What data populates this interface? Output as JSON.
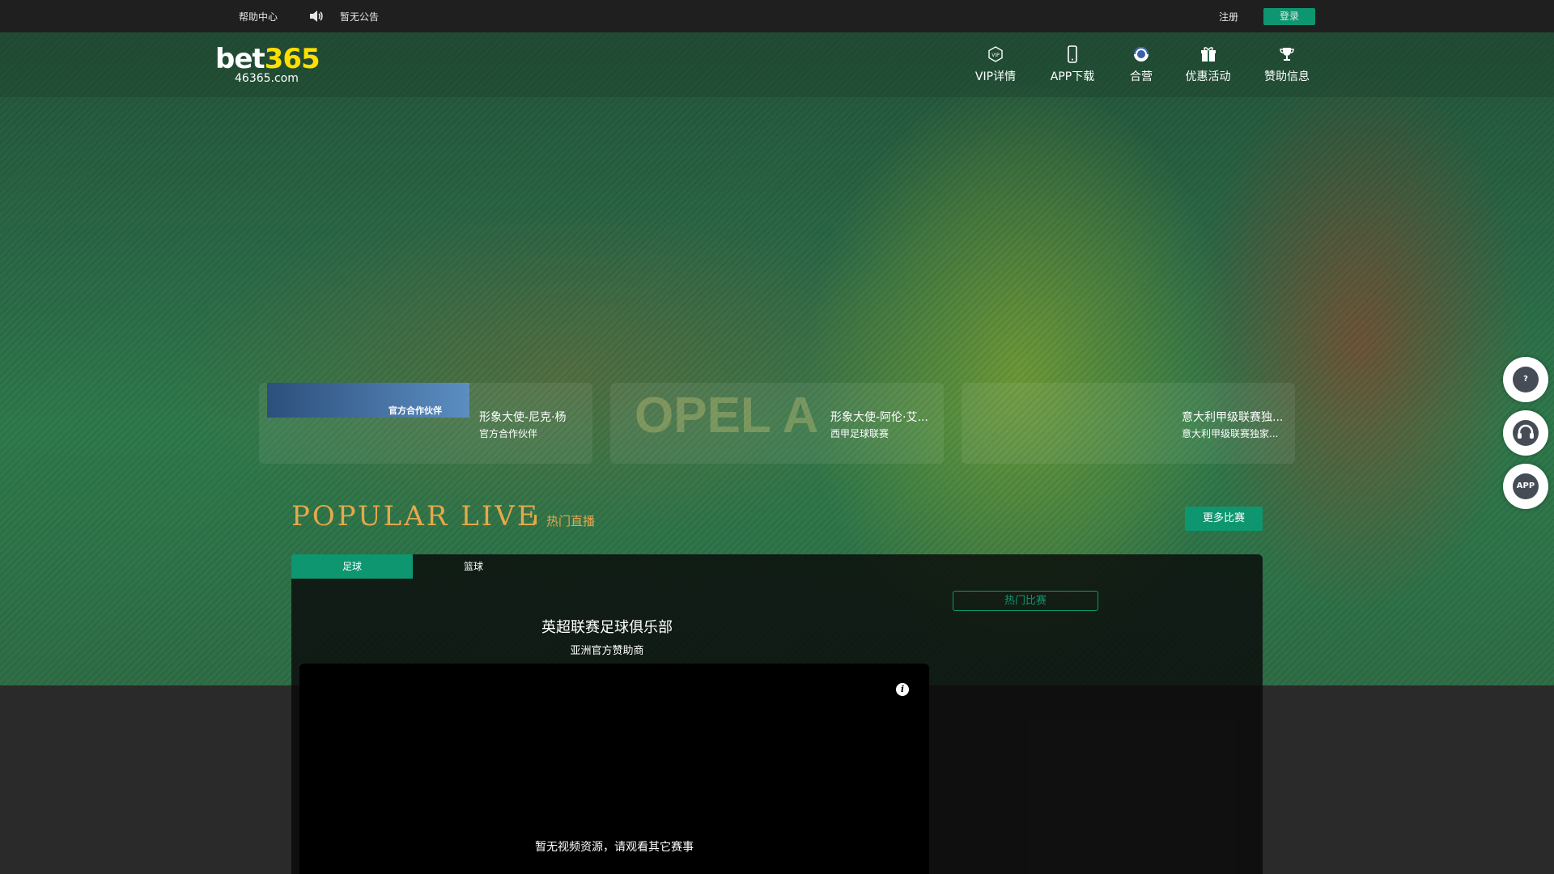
{
  "topbar": {
    "help": "帮助中心",
    "notice": "暂无公告",
    "register": "注册",
    "login": "登录"
  },
  "logo": {
    "brand_prefix": "bet",
    "brand_number": "365",
    "domain": "46365.com"
  },
  "nav": {
    "items": [
      {
        "label": "VIP详情",
        "icon": "vip-icon"
      },
      {
        "label": "APP下载",
        "icon": "phone-icon"
      },
      {
        "label": "合营",
        "icon": "partner-icon"
      },
      {
        "label": "优惠活动",
        "icon": "gift-icon"
      },
      {
        "label": "赞助信息",
        "icon": "trophy-icon"
      }
    ]
  },
  "cards": [
    {
      "title": "形象大使-尼克·杨",
      "sub": "官方合作伙伴",
      "thumb_text": "官方合作伙伴"
    },
    {
      "title": "形象大使-阿伦·艾...",
      "sub": "西甲足球联赛",
      "thumb_text": "OPEL AREN"
    },
    {
      "title": "意大利甲级联赛独...",
      "sub": "意大利甲级联赛独家...",
      "thumb_text": ""
    }
  ],
  "popular": {
    "en": "POPULAR LIVE",
    "cn": "热门直播",
    "more": "更多比赛"
  },
  "tabs": [
    "足球",
    "篮球"
  ],
  "live": {
    "title": "英超联赛足球俱乐部",
    "subtitle": "亚洲官方赞助商",
    "info": "i",
    "no_video": "暂无视频资源，请观看其它赛事",
    "hot": "热门比赛"
  },
  "side": [
    {
      "icon": "help-icon",
      "text": "?"
    },
    {
      "icon": "customer-service-icon",
      "text": ""
    },
    {
      "icon": "app-icon",
      "text": "APP"
    }
  ],
  "colors": {
    "accent": "#0e9670",
    "gold": "#e5a84b",
    "logo_number": "#ffde00"
  }
}
